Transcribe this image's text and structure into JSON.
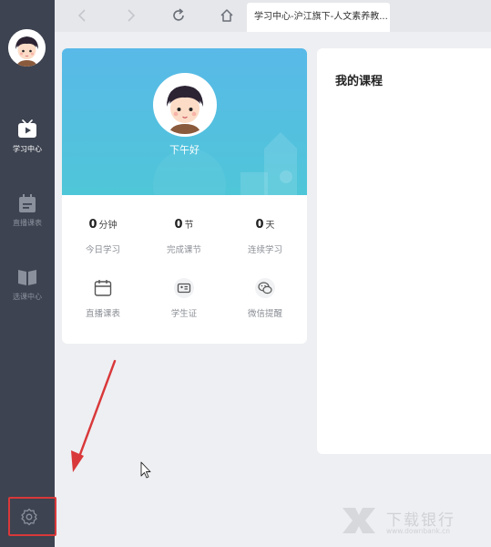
{
  "browser": {
    "tab_title": "学习中心-沪江旗下-人文素养教..."
  },
  "sidebar": {
    "items": [
      {
        "label": "学习中心",
        "icon": "play-icon",
        "active": true
      },
      {
        "label": "直播课表",
        "icon": "calendar-icon",
        "active": false
      },
      {
        "label": "选课中心",
        "icon": "book-icon",
        "active": false
      }
    ],
    "settings_icon": "gear-icon"
  },
  "profile": {
    "greeting": "下午好",
    "stats": [
      {
        "value": "0",
        "unit": "分钟",
        "caption": "今日学习"
      },
      {
        "value": "0",
        "unit": "节",
        "caption": "完成课节"
      },
      {
        "value": "0",
        "unit": "天",
        "caption": "连续学习"
      }
    ],
    "tools": [
      {
        "label": "直播课表",
        "icon": "calendar-icon"
      },
      {
        "label": "学生证",
        "icon": "id-card-icon"
      },
      {
        "label": "微信提醒",
        "icon": "wechat-icon"
      }
    ]
  },
  "courses": {
    "title": "我的课程"
  },
  "watermark": {
    "text": "下载银行",
    "url": "www.downbank.cn"
  },
  "colors": {
    "sidebar_bg": "#3d4350",
    "banner_start": "#59b9e8",
    "banner_end": "#4fc6d8",
    "highlight_red": "#d9383a"
  }
}
